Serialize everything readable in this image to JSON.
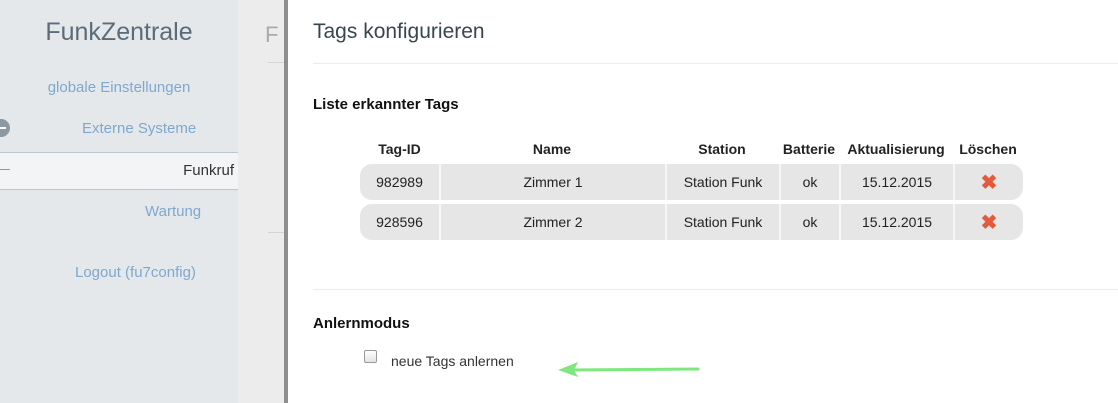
{
  "sidebar": {
    "brand": "FunkZentrale",
    "items": [
      {
        "label": "globale Einstellungen"
      },
      {
        "label": "Externe Systeme"
      },
      {
        "label": "Funkruf"
      },
      {
        "label": "Wartung"
      },
      {
        "label": "Logout (fu7config)"
      }
    ]
  },
  "midcol": {
    "letter": "F"
  },
  "main": {
    "title": "Tags konfigurieren",
    "tags_section": {
      "title": "Liste erkannter Tags",
      "columns": [
        "Tag-ID",
        "Name",
        "Station",
        "Batterie",
        "Aktualisierung",
        "Löschen"
      ],
      "rows": [
        {
          "tag_id": "982989",
          "name": "Zimmer 1",
          "station": "Station Funk",
          "battery": "ok",
          "updated": "15.12.2015",
          "delete": "✖"
        },
        {
          "tag_id": "928596",
          "name": "Zimmer 2",
          "station": "Station Funk",
          "battery": "ok",
          "updated": "15.12.2015",
          "delete": "✖"
        }
      ]
    },
    "learn_section": {
      "title": "Anlernmodus",
      "checkbox_label": "neue Tags anlernen",
      "checked": false
    }
  },
  "colors": {
    "sidebar_bg": "#e4e8eb",
    "link": "#7fa8cf",
    "delete": "#e45a3a",
    "arrow": "#7ee87e"
  },
  "icons": [
    "expand-icon",
    "delete-icon",
    "arrow-icon"
  ]
}
